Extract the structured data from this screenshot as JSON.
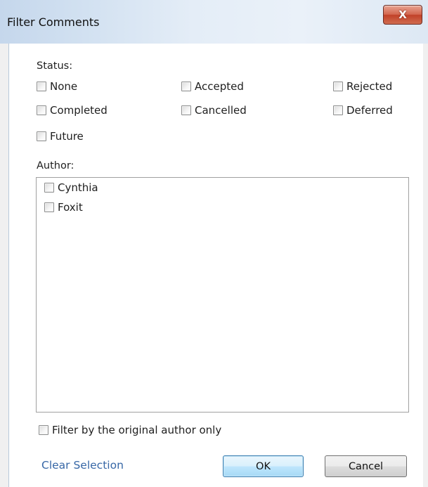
{
  "window": {
    "title": "Filter Comments",
    "close_glyph": "X"
  },
  "status": {
    "label": "Status:",
    "options": [
      {
        "label": "None",
        "checked": false
      },
      {
        "label": "Accepted",
        "checked": false
      },
      {
        "label": "Rejected",
        "checked": false
      },
      {
        "label": "Completed",
        "checked": false
      },
      {
        "label": "Cancelled",
        "checked": false
      },
      {
        "label": "Deferred",
        "checked": false
      },
      {
        "label": "Future",
        "checked": false
      }
    ]
  },
  "author": {
    "label": "Author:",
    "items": [
      {
        "label": "Cynthia",
        "checked": false
      },
      {
        "label": "Foxit",
        "checked": false
      }
    ]
  },
  "filter_original": {
    "label": "Filter by the original author only",
    "checked": false
  },
  "footer": {
    "clear_selection": "Clear Selection",
    "ok": "OK",
    "cancel": "Cancel"
  },
  "colors": {
    "link": "#3767a6",
    "close_button": "#c14128",
    "ok_border": "#3c7fb1"
  }
}
